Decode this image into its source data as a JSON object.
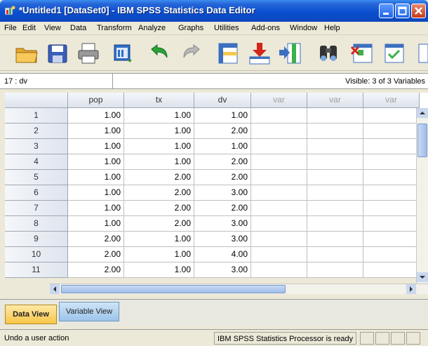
{
  "window": {
    "title": "*Untitled1 [DataSet0] - IBM SPSS Statistics Data Editor"
  },
  "menu": [
    "File",
    "Edit",
    "View",
    "Data",
    "Transform",
    "Analyze",
    "Graphs",
    "Utilities",
    "Add-ons",
    "Window",
    "Help"
  ],
  "toolbar": [
    "open-folder-icon",
    "save-icon",
    "print-icon",
    "dialog-recall-icon",
    "undo-icon",
    "redo-icon",
    "goto-case-icon",
    "insert-cases-icon",
    "insert-variable-icon",
    "find-icon",
    "split-file-icon",
    "select-cases-icon"
  ],
  "cellbar": {
    "reference": "17 : dv",
    "visible": "Visible: 3 of 3 Variables"
  },
  "grid": {
    "columns": [
      "pop",
      "tx",
      "dv",
      "var",
      "var",
      "var"
    ],
    "rows": [
      {
        "n": "1",
        "pop": "1.00",
        "tx": "1.00",
        "dv": "1.00"
      },
      {
        "n": "2",
        "pop": "1.00",
        "tx": "1.00",
        "dv": "2.00"
      },
      {
        "n": "3",
        "pop": "1.00",
        "tx": "1.00",
        "dv": "1.00"
      },
      {
        "n": "4",
        "pop": "1.00",
        "tx": "1.00",
        "dv": "2.00"
      },
      {
        "n": "5",
        "pop": "1.00",
        "tx": "2.00",
        "dv": "2.00"
      },
      {
        "n": "6",
        "pop": "1.00",
        "tx": "2.00",
        "dv": "3.00"
      },
      {
        "n": "7",
        "pop": "1.00",
        "tx": "2.00",
        "dv": "2.00"
      },
      {
        "n": "8",
        "pop": "1.00",
        "tx": "2.00",
        "dv": "3.00"
      },
      {
        "n": "9",
        "pop": "2.00",
        "tx": "1.00",
        "dv": "3.00"
      },
      {
        "n": "10",
        "pop": "2.00",
        "tx": "1.00",
        "dv": "4.00"
      },
      {
        "n": "11",
        "pop": "2.00",
        "tx": "1.00",
        "dv": "3.00"
      }
    ]
  },
  "tabs": {
    "data_view": "Data View",
    "variable_view": "Variable View"
  },
  "status": {
    "left": "Undo a user action",
    "right": "IBM SPSS Statistics Processor is ready"
  }
}
